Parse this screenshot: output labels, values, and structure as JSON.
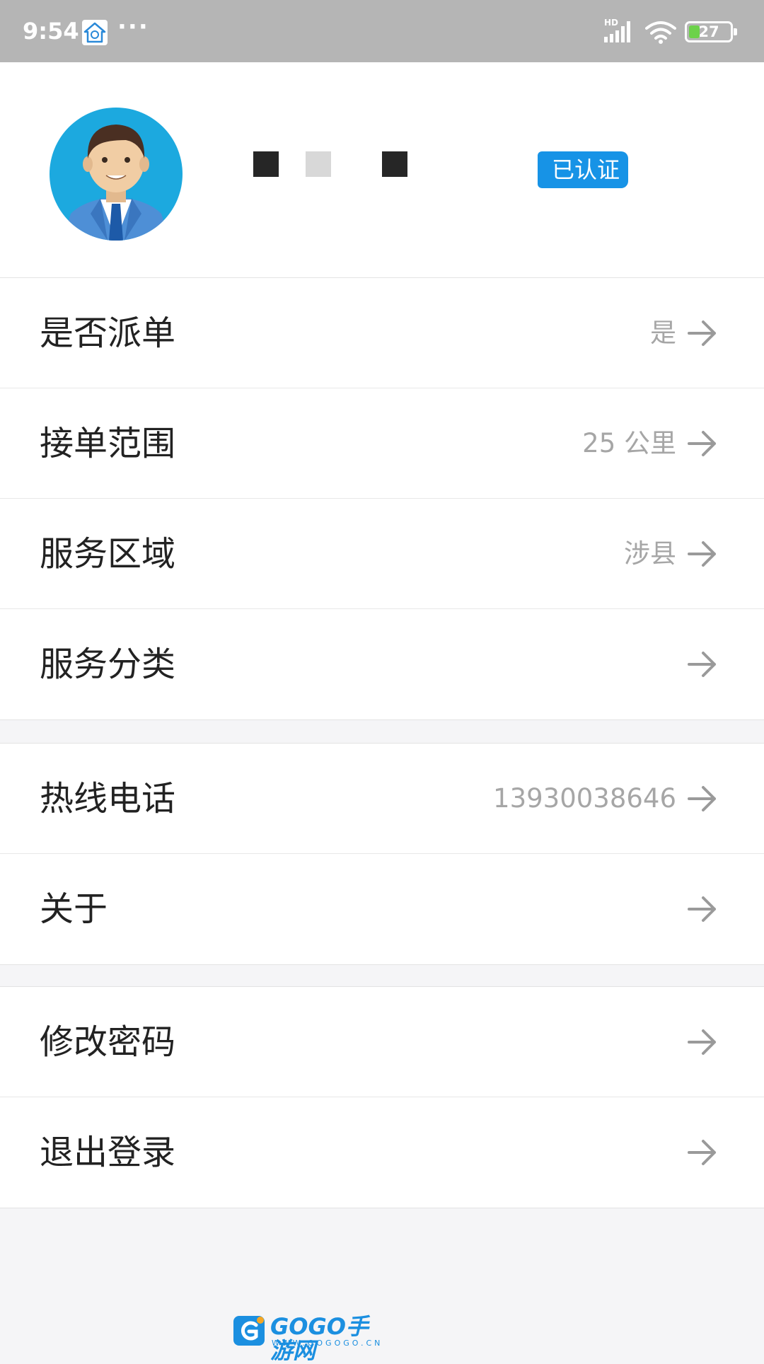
{
  "status_bar": {
    "time": "9:54",
    "overflow_indicator": "···",
    "network_label": "HD",
    "battery_percent": "27",
    "battery_level": 0.27,
    "app_icon": "home-notification-icon",
    "signal_icon": "cellular-signal-icon",
    "wifi_icon": "wifi-icon"
  },
  "profile": {
    "avatar_icon": "businessman-avatar-icon",
    "verified_label": "已认证"
  },
  "menu": {
    "group1": [
      {
        "label": "是否派单",
        "value": "是"
      },
      {
        "label": "接单范围",
        "value": "25 公里"
      },
      {
        "label": "服务区域",
        "value": "涉县"
      },
      {
        "label": "服务分类",
        "value": ""
      }
    ],
    "group2": [
      {
        "label": "热线电话",
        "value": "13930038646"
      },
      {
        "label": "关于",
        "value": ""
      }
    ],
    "group3": [
      {
        "label": "修改密码",
        "value": ""
      },
      {
        "label": "退出登录",
        "value": ""
      }
    ],
    "arrow_icon": "arrow-right-icon"
  },
  "watermark": {
    "brand": "GOGO手游网",
    "url": "WWW.GOGOGO.CN"
  },
  "colors": {
    "status_bar_bg": "#b5b5b5",
    "accent_blue": "#1793e6",
    "battery_green": "#6dd24a",
    "page_bg": "#f5f5f7"
  }
}
